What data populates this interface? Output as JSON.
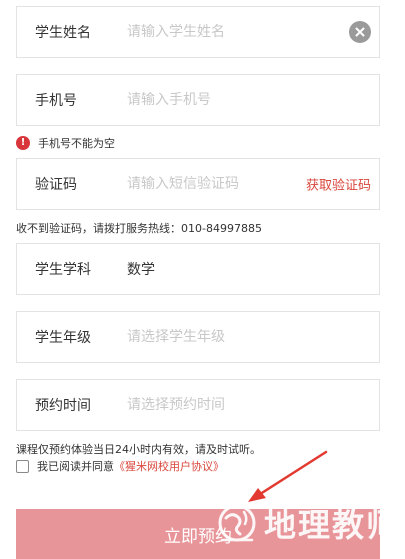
{
  "form": {
    "student_name": {
      "label": "学生姓名",
      "placeholder": "请输入学生姓名",
      "value": ""
    },
    "phone": {
      "label": "手机号",
      "placeholder": "请输入手机号",
      "value": ""
    },
    "phone_error": "手机号不能为空",
    "verify_code": {
      "label": "验证码",
      "placeholder": "请输入短信验证码",
      "value": "",
      "button": "获取验证码"
    },
    "no_code_hint": "收不到验证码，请拨打服务热线：010-84997885",
    "subject": {
      "label": "学生学科",
      "value": "数学"
    },
    "grade": {
      "label": "学生年级",
      "placeholder": "请选择学生年级",
      "value": ""
    },
    "appointment_time": {
      "label": "预约时间",
      "placeholder": "请选择预约时间",
      "value": ""
    },
    "course_notice": "课程仅预约体验当日24小时内有效，请及时试听。",
    "agreement": {
      "prefix": "我已阅读并同意",
      "link": "《猩米网校用户协议》",
      "checked": false
    },
    "submit_label": "立即预约"
  },
  "watermark": "地理教师",
  "colors": {
    "accent": "#d9463b",
    "button": "#e8959a",
    "border": "#e3e3e3",
    "error": "#d9363b"
  }
}
